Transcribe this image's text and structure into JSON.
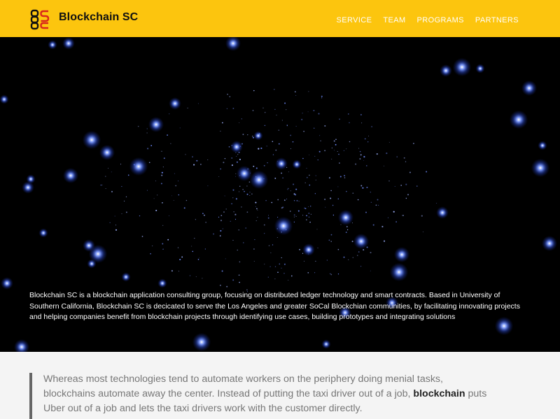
{
  "brand": {
    "name": "Blockchain SC"
  },
  "nav": {
    "items": [
      "SERVICE",
      "TEAM",
      "PROGRAMS",
      "PARTNERS"
    ]
  },
  "hero": {
    "description": "Blockchain SC is a blockchain application consulting group, focusing on distributed ledger technology and smart contracts. Based in University of Southern California, Blockchain SC is decicated to serve the Los Angeles and greater SoCal Blockchian communities, by facilitating innovating projects and helping companies benefit from blockchain projects through identifying use cases, building prototypes and integrating solutions"
  },
  "quote": {
    "part1": "Whereas most technologies tend to automate workers on the periphery doing menial tasks, blockchains automate away the center. Instead of putting the taxi driver out of a job, ",
    "emphasis": "blockchain",
    "part2": " puts Uber out of a job and lets the taxi drivers work with the customer directly."
  },
  "colors": {
    "brand_yellow": "#fcc50e",
    "logo_red": "#d9261c",
    "star_blue": "#4a6cff"
  },
  "icons": {
    "logo": "blockchain-chain-logo-icon"
  }
}
